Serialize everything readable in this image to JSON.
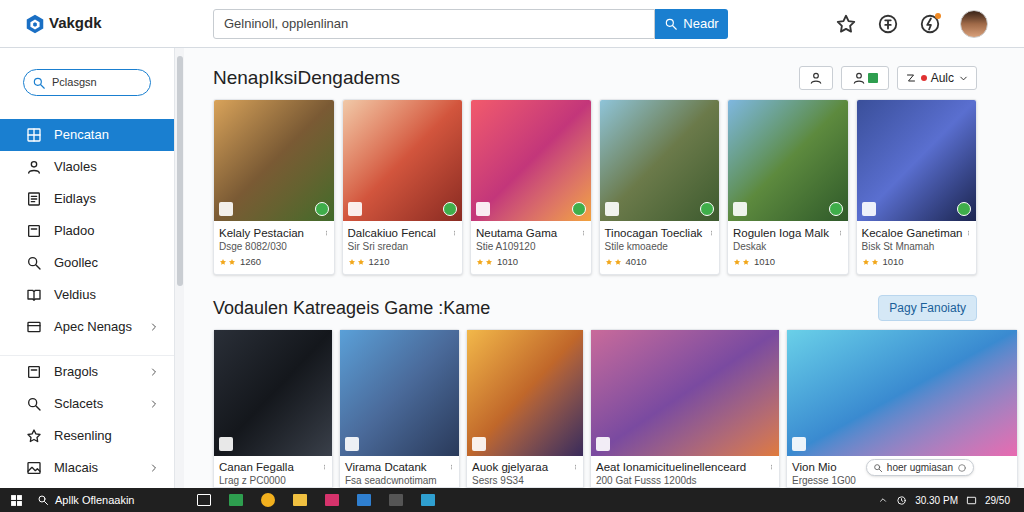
{
  "header": {
    "logo": "Vakgdk",
    "search_placeholder": "Gelninoll, opplenlinan",
    "search_button": "Neadr"
  },
  "sidebar": {
    "search_placeholder": "Pclasgsn",
    "groups": [
      [
        {
          "label": "Pencatan",
          "selected": true,
          "expandable": false
        },
        {
          "label": "Vlaoles",
          "selected": false,
          "expandable": false
        },
        {
          "label": "Eidlays",
          "selected": false,
          "expandable": false
        },
        {
          "label": "Pladoo",
          "selected": false,
          "expandable": false
        },
        {
          "label": "Goollec",
          "selected": false,
          "expandable": false
        },
        {
          "label": "Veldius",
          "selected": false,
          "expandable": false
        },
        {
          "label": "Apec Nenags",
          "selected": false,
          "expandable": true
        }
      ],
      [
        {
          "label": "Bragols",
          "selected": false,
          "expandable": true
        },
        {
          "label": "Sclacets",
          "selected": false,
          "expandable": true
        },
        {
          "label": "Resenling",
          "selected": false,
          "expandable": false
        },
        {
          "label": "Mlacais",
          "selected": false,
          "expandable": true
        }
      ]
    ]
  },
  "toolbar": {
    "sort_label": "Aulc"
  },
  "sections": [
    {
      "title": "NenapIksiDengadems",
      "cards": [
        {
          "title": "Kelaly Pestacian",
          "subtitle": "Dsge 8082/030",
          "stars": 2,
          "rating": "1260"
        },
        {
          "title": "Dalcakiuo Fencal",
          "subtitle": "Sir Sri sredan",
          "stars": 2,
          "rating": "1210"
        },
        {
          "title": "Neutama Gama",
          "subtitle": "Stie A109120",
          "stars": 2,
          "rating": "1010"
        },
        {
          "title": "Tinocagan Toecliak",
          "subtitle": "Stile kmoaede",
          "stars": 2,
          "rating": "4010"
        },
        {
          "title": "Rogulen Ioga Malk",
          "subtitle": "Deskak",
          "stars": 2,
          "rating": "1010"
        },
        {
          "title": "Kecaloe Ganetiman",
          "subtitle": "Bisk St Mnamah",
          "stars": 2,
          "rating": "1010"
        }
      ]
    },
    {
      "title": "Vodaulen Katreageis Game :Kame",
      "button": "Pagy Fanoiaty",
      "cards": [
        {
          "title": "Canan Fegalla",
          "subtitle": "Lrag z PC0000"
        },
        {
          "title": "Virama Dcatank",
          "subtitle": "Fsa seadcwnotimam"
        },
        {
          "title": "Auok gjelyaraa",
          "subtitle": "Sesrs 9S34"
        },
        {
          "title": "Aeat Ionamicituelinellenceard",
          "subtitle": "200 Gat Fusss 1200ds"
        },
        {
          "title": "Vion Mio",
          "subtitle": "Ergesse 1G00"
        }
      ]
    }
  ],
  "overlay": {
    "label": "hoer ugmiasan"
  },
  "taskbar": {
    "search": "Apllk Oflenaakin",
    "time": "30.30 PM",
    "date": "29/50"
  }
}
